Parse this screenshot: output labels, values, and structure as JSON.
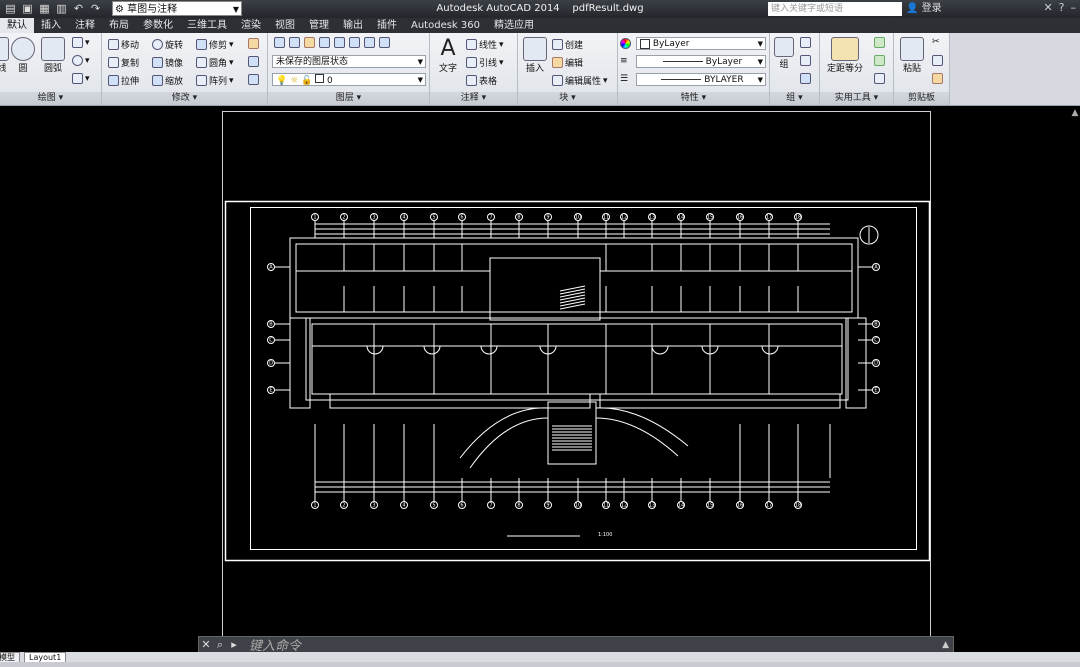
{
  "titlebar": {
    "app_title": "Autodesk AutoCAD 2014",
    "file_name": "pdfResult.dwg",
    "workspace": "草图与注释",
    "search_placeholder": "键入关键字或短语",
    "login_label": "登录"
  },
  "tabs": [
    "默认",
    "插入",
    "注释",
    "布局",
    "参数化",
    "三维工具",
    "渲染",
    "视图",
    "管理",
    "输出",
    "插件",
    "Autodesk 360",
    "精选应用"
  ],
  "ribbon": {
    "draw": {
      "line": "线",
      "circle": "圆",
      "arc": "圆弧",
      "footer": "绘图"
    },
    "modify": {
      "move": "移动",
      "rotate": "旋转",
      "trim": "修剪",
      "copy": "复制",
      "mirror": "镜像",
      "fillet": "圆角",
      "stretch": "拉伸",
      "scale": "缩放",
      "array": "阵列",
      "footer": "修改"
    },
    "layers": {
      "layer_state": "未保存的图层状态",
      "current_layer": "0",
      "footer": "图层"
    },
    "annotation": {
      "text": "文字",
      "linear": "线性",
      "leader": "引线",
      "table": "表格",
      "footer": "注释"
    },
    "block": {
      "insert": "插入",
      "create": "创建",
      "edit": "编辑",
      "edit_attr": "编辑属性",
      "footer": "块"
    },
    "properties": {
      "color": "ByLayer",
      "linetype": "ByLayer",
      "lineweight": "BYLAYER",
      "footer": "特性"
    },
    "groups": {
      "group": "组",
      "footer": "组"
    },
    "utilities": {
      "measure": "定距等分",
      "footer": "实用工具"
    },
    "clipboard": {
      "paste": "粘贴",
      "footer": "剪贴板"
    }
  },
  "drawing": {
    "scale_label": "1:100",
    "grid_top": [
      "1",
      "2",
      "3",
      "4",
      "5",
      "6",
      "7",
      "8",
      "9",
      "10",
      "11",
      "12",
      "13",
      "14",
      "15",
      "16",
      "17",
      "18"
    ],
    "grid_left": [
      "A",
      "B",
      "C",
      "D",
      "E",
      "F"
    ],
    "grid_right": [
      "A",
      "B",
      "C",
      "D",
      "E",
      "F"
    ]
  },
  "command_line": {
    "prompt": "键入命令"
  },
  "layout_tabs": [
    "模型",
    "Layout1"
  ]
}
